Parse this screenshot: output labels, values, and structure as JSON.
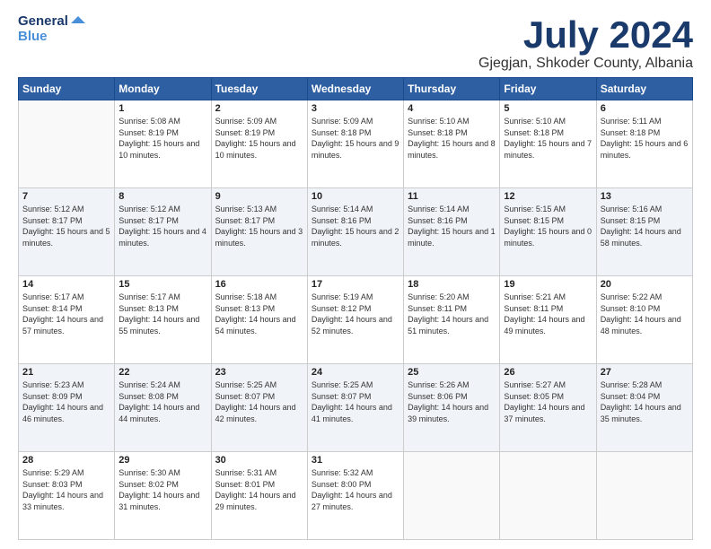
{
  "logo": {
    "line1": "General",
    "line2": "Blue"
  },
  "title": "July 2024",
  "location": "Gjegjan, Shkoder County, Albania",
  "headers": [
    "Sunday",
    "Monday",
    "Tuesday",
    "Wednesday",
    "Thursday",
    "Friday",
    "Saturday"
  ],
  "weeks": [
    [
      {
        "day": "",
        "sunrise": "",
        "sunset": "",
        "daylight": ""
      },
      {
        "day": "1",
        "sunrise": "Sunrise: 5:08 AM",
        "sunset": "Sunset: 8:19 PM",
        "daylight": "Daylight: 15 hours and 10 minutes."
      },
      {
        "day": "2",
        "sunrise": "Sunrise: 5:09 AM",
        "sunset": "Sunset: 8:19 PM",
        "daylight": "Daylight: 15 hours and 10 minutes."
      },
      {
        "day": "3",
        "sunrise": "Sunrise: 5:09 AM",
        "sunset": "Sunset: 8:18 PM",
        "daylight": "Daylight: 15 hours and 9 minutes."
      },
      {
        "day": "4",
        "sunrise": "Sunrise: 5:10 AM",
        "sunset": "Sunset: 8:18 PM",
        "daylight": "Daylight: 15 hours and 8 minutes."
      },
      {
        "day": "5",
        "sunrise": "Sunrise: 5:10 AM",
        "sunset": "Sunset: 8:18 PM",
        "daylight": "Daylight: 15 hours and 7 minutes."
      },
      {
        "day": "6",
        "sunrise": "Sunrise: 5:11 AM",
        "sunset": "Sunset: 8:18 PM",
        "daylight": "Daylight: 15 hours and 6 minutes."
      }
    ],
    [
      {
        "day": "7",
        "sunrise": "Sunrise: 5:12 AM",
        "sunset": "Sunset: 8:17 PM",
        "daylight": "Daylight: 15 hours and 5 minutes."
      },
      {
        "day": "8",
        "sunrise": "Sunrise: 5:12 AM",
        "sunset": "Sunset: 8:17 PM",
        "daylight": "Daylight: 15 hours and 4 minutes."
      },
      {
        "day": "9",
        "sunrise": "Sunrise: 5:13 AM",
        "sunset": "Sunset: 8:17 PM",
        "daylight": "Daylight: 15 hours and 3 minutes."
      },
      {
        "day": "10",
        "sunrise": "Sunrise: 5:14 AM",
        "sunset": "Sunset: 8:16 PM",
        "daylight": "Daylight: 15 hours and 2 minutes."
      },
      {
        "day": "11",
        "sunrise": "Sunrise: 5:14 AM",
        "sunset": "Sunset: 8:16 PM",
        "daylight": "Daylight: 15 hours and 1 minute."
      },
      {
        "day": "12",
        "sunrise": "Sunrise: 5:15 AM",
        "sunset": "Sunset: 8:15 PM",
        "daylight": "Daylight: 15 hours and 0 minutes."
      },
      {
        "day": "13",
        "sunrise": "Sunrise: 5:16 AM",
        "sunset": "Sunset: 8:15 PM",
        "daylight": "Daylight: 14 hours and 58 minutes."
      }
    ],
    [
      {
        "day": "14",
        "sunrise": "Sunrise: 5:17 AM",
        "sunset": "Sunset: 8:14 PM",
        "daylight": "Daylight: 14 hours and 57 minutes."
      },
      {
        "day": "15",
        "sunrise": "Sunrise: 5:17 AM",
        "sunset": "Sunset: 8:13 PM",
        "daylight": "Daylight: 14 hours and 55 minutes."
      },
      {
        "day": "16",
        "sunrise": "Sunrise: 5:18 AM",
        "sunset": "Sunset: 8:13 PM",
        "daylight": "Daylight: 14 hours and 54 minutes."
      },
      {
        "day": "17",
        "sunrise": "Sunrise: 5:19 AM",
        "sunset": "Sunset: 8:12 PM",
        "daylight": "Daylight: 14 hours and 52 minutes."
      },
      {
        "day": "18",
        "sunrise": "Sunrise: 5:20 AM",
        "sunset": "Sunset: 8:11 PM",
        "daylight": "Daylight: 14 hours and 51 minutes."
      },
      {
        "day": "19",
        "sunrise": "Sunrise: 5:21 AM",
        "sunset": "Sunset: 8:11 PM",
        "daylight": "Daylight: 14 hours and 49 minutes."
      },
      {
        "day": "20",
        "sunrise": "Sunrise: 5:22 AM",
        "sunset": "Sunset: 8:10 PM",
        "daylight": "Daylight: 14 hours and 48 minutes."
      }
    ],
    [
      {
        "day": "21",
        "sunrise": "Sunrise: 5:23 AM",
        "sunset": "Sunset: 8:09 PM",
        "daylight": "Daylight: 14 hours and 46 minutes."
      },
      {
        "day": "22",
        "sunrise": "Sunrise: 5:24 AM",
        "sunset": "Sunset: 8:08 PM",
        "daylight": "Daylight: 14 hours and 44 minutes."
      },
      {
        "day": "23",
        "sunrise": "Sunrise: 5:25 AM",
        "sunset": "Sunset: 8:07 PM",
        "daylight": "Daylight: 14 hours and 42 minutes."
      },
      {
        "day": "24",
        "sunrise": "Sunrise: 5:25 AM",
        "sunset": "Sunset: 8:07 PM",
        "daylight": "Daylight: 14 hours and 41 minutes."
      },
      {
        "day": "25",
        "sunrise": "Sunrise: 5:26 AM",
        "sunset": "Sunset: 8:06 PM",
        "daylight": "Daylight: 14 hours and 39 minutes."
      },
      {
        "day": "26",
        "sunrise": "Sunrise: 5:27 AM",
        "sunset": "Sunset: 8:05 PM",
        "daylight": "Daylight: 14 hours and 37 minutes."
      },
      {
        "day": "27",
        "sunrise": "Sunrise: 5:28 AM",
        "sunset": "Sunset: 8:04 PM",
        "daylight": "Daylight: 14 hours and 35 minutes."
      }
    ],
    [
      {
        "day": "28",
        "sunrise": "Sunrise: 5:29 AM",
        "sunset": "Sunset: 8:03 PM",
        "daylight": "Daylight: 14 hours and 33 minutes."
      },
      {
        "day": "29",
        "sunrise": "Sunrise: 5:30 AM",
        "sunset": "Sunset: 8:02 PM",
        "daylight": "Daylight: 14 hours and 31 minutes."
      },
      {
        "day": "30",
        "sunrise": "Sunrise: 5:31 AM",
        "sunset": "Sunset: 8:01 PM",
        "daylight": "Daylight: 14 hours and 29 minutes."
      },
      {
        "day": "31",
        "sunrise": "Sunrise: 5:32 AM",
        "sunset": "Sunset: 8:00 PM",
        "daylight": "Daylight: 14 hours and 27 minutes."
      },
      {
        "day": "",
        "sunrise": "",
        "sunset": "",
        "daylight": ""
      },
      {
        "day": "",
        "sunrise": "",
        "sunset": "",
        "daylight": ""
      },
      {
        "day": "",
        "sunrise": "",
        "sunset": "",
        "daylight": ""
      }
    ]
  ]
}
